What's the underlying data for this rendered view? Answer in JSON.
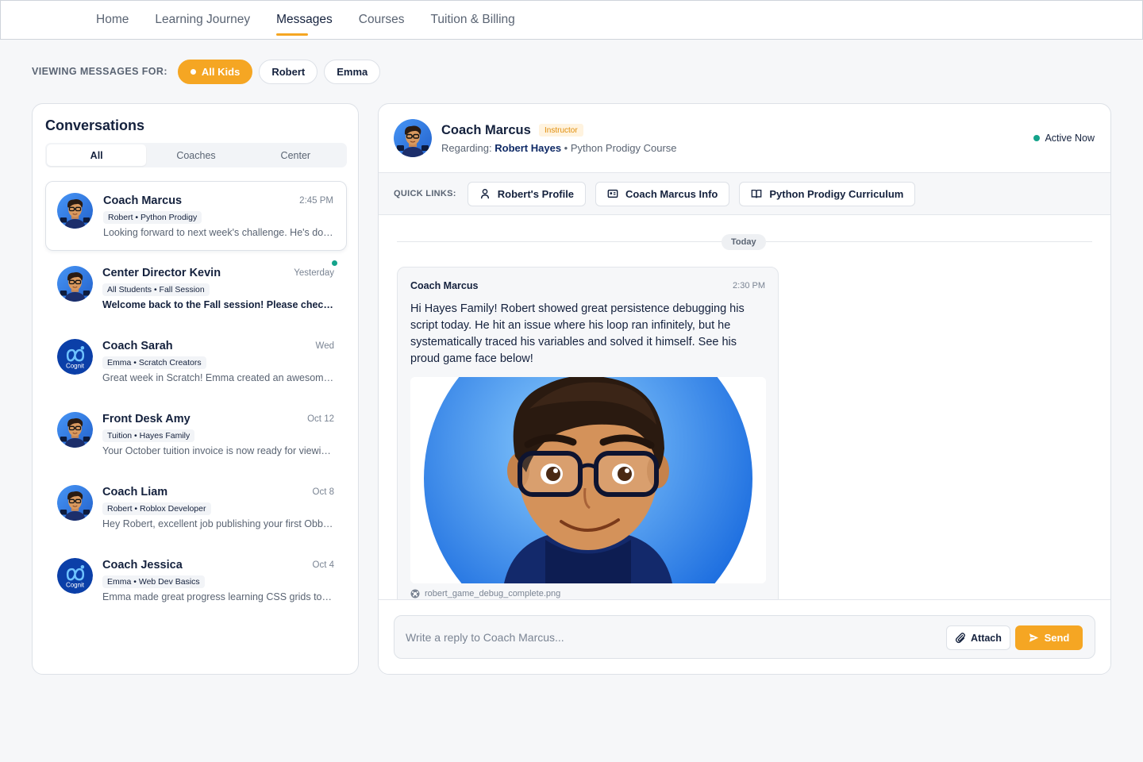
{
  "nav": {
    "items": [
      {
        "label": "Home",
        "active": false
      },
      {
        "label": "Learning Journey",
        "active": false
      },
      {
        "label": "Messages",
        "active": true
      },
      {
        "label": "Courses",
        "active": false
      },
      {
        "label": "Tuition & Billing",
        "active": false
      }
    ]
  },
  "viewing": {
    "label": "VIEWING MESSAGES FOR:",
    "kids": [
      {
        "label": "All Kids",
        "active": true
      },
      {
        "label": "Robert",
        "active": false
      },
      {
        "label": "Emma",
        "active": false
      }
    ]
  },
  "conversations": {
    "title": "Conversations",
    "tabs": [
      {
        "label": "All",
        "active": true
      },
      {
        "label": "Coaches",
        "active": false
      },
      {
        "label": "Center",
        "active": false
      }
    ],
    "items": [
      {
        "name": "Coach Marcus",
        "time": "2:45 PM",
        "tag": "Robert • Python Prodigy",
        "preview": "Looking forward to next week's challenge. He's doing great.",
        "avatar": "boy-avatar",
        "selected": true,
        "unread": false
      },
      {
        "name": "Center Director Kevin",
        "time": "Yesterday",
        "tag": "All Students • Fall Session",
        "preview": "Welcome back to the Fall session! Please check the new schedule.",
        "avatar": "boy-avatar",
        "selected": false,
        "unread": true
      },
      {
        "name": "Coach Sarah",
        "time": "Wed",
        "tag": "Emma • Scratch Creators",
        "preview": "Great week in Scratch! Emma created an awesome animation.",
        "avatar": "cognit-logo",
        "selected": false,
        "unread": false
      },
      {
        "name": "Front Desk Amy",
        "time": "Oct 12",
        "tag": "Tuition • Hayes Family",
        "preview": "Your October tuition invoice is now ready for viewing.",
        "avatar": "boy-avatar",
        "selected": false,
        "unread": false
      },
      {
        "name": "Coach Liam",
        "time": "Oct 8",
        "tag": "Robert • Roblox Developer",
        "preview": "Hey Robert, excellent job publishing your first Obby game!",
        "avatar": "boy-avatar",
        "selected": false,
        "unread": false
      },
      {
        "name": "Coach Jessica",
        "time": "Oct 4",
        "tag": "Emma • Web Dev Basics",
        "preview": "Emma made great progress learning CSS grids today.",
        "avatar": "cognit-logo",
        "selected": false,
        "unread": false
      }
    ],
    "logo_text": "Cognit"
  },
  "chat": {
    "name": "Coach Marcus",
    "badge": "Instructor",
    "regarding_prefix": "Regarding:",
    "student": "Robert Hayes",
    "course": "• Python Prodigy Course",
    "status": "Active Now",
    "quick_links_label": "QUICK LINKS:",
    "quick_links": [
      {
        "label": "Robert's Profile",
        "icon": "user-icon"
      },
      {
        "label": "Coach Marcus Info",
        "icon": "id-card-icon"
      },
      {
        "label": "Python Prodigy Curriculum",
        "icon": "book-icon"
      }
    ],
    "day_label": "Today",
    "message": {
      "sender": "Coach Marcus",
      "time": "2:30 PM",
      "text": "Hi Hayes Family! Robert showed great persistence debugging his script today. He hit an issue where his loop ran infinitely, but he systematically traced his variables and solved it himself. See his proud game face below!",
      "attachment": "robert_game_debug_complete.png"
    },
    "reply_placeholder": "Write a reply to Coach Marcus...",
    "attach_label": "Attach",
    "send_label": "Send"
  },
  "colors": {
    "accent": "#f5a623",
    "navy": "#14213d",
    "online": "#14a38b",
    "avatar_blue": "#1e6fe0"
  }
}
